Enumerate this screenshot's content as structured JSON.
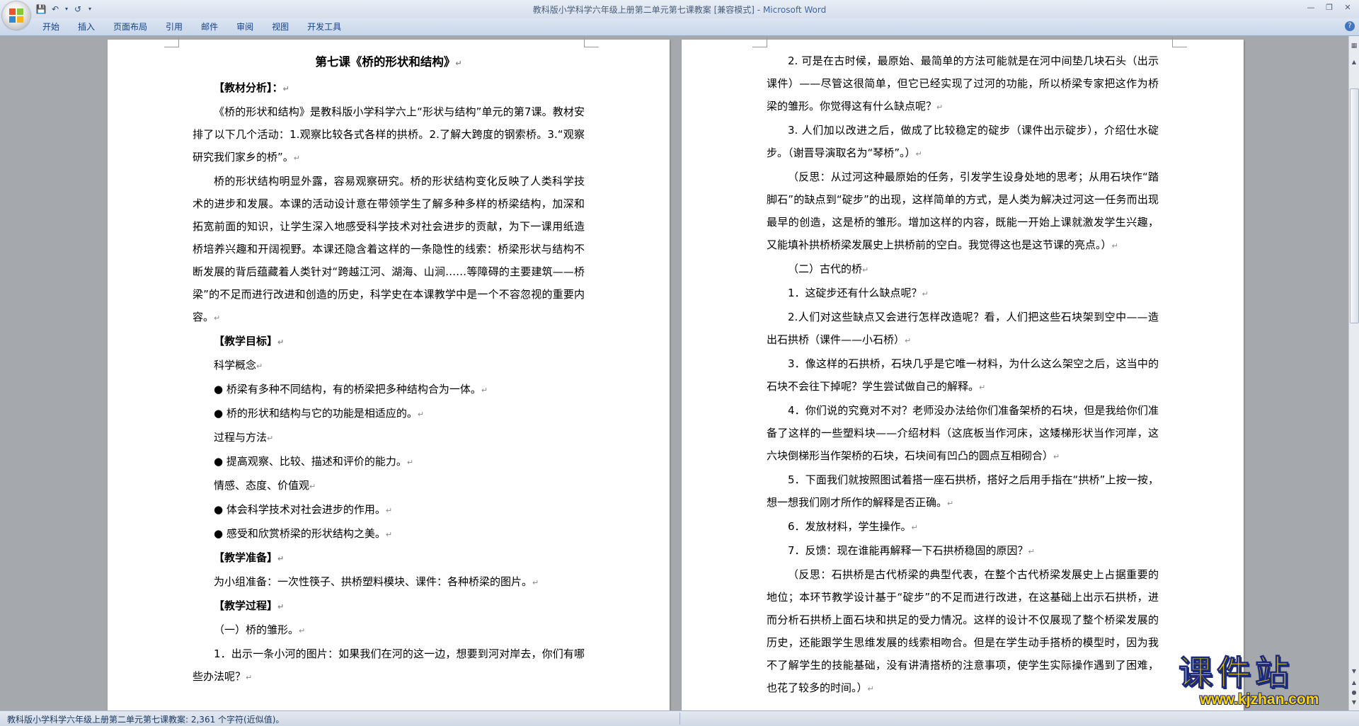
{
  "window": {
    "doc_title": "教科版小学科学六年级上册第二单元第七课教案 [兼容模式]",
    "separator": " - ",
    "app_name": "Microsoft Word"
  },
  "qat": {
    "save_icon": "save-icon",
    "undo_icon": "undo-icon",
    "redo_icon": "redo-icon",
    "customize_icon": "dropdown-icon"
  },
  "ribbon": {
    "tabs": [
      "开始",
      "插入",
      "页面布局",
      "引用",
      "邮件",
      "审阅",
      "视图",
      "开发工具"
    ]
  },
  "page1": {
    "title": "第七课《桥的形状和结构》",
    "paragraphs": [
      "【教材分析】：",
      "《桥的形状和结构》是教科版小学科学六上“形状与结构”单元的第7课。教材安排了以下几个活动：1.观察比较各式各样的拱桥。2.了解大跨度的钢索桥。3.“观察研究我们家乡的桥”。",
      "桥的形状结构明显外露，容易观察研究。桥的形状结构变化反映了人类科学技术的进步和发展。本课的活动设计意在带领学生了解多种多样的桥梁结构，加深和拓宽前面的知识，让学生深入地感受科学技术对社会进步的贡献，为下一课用纸造桥培养兴趣和开阔视野。本课还隐含着这样的一条隐性的线索：桥梁形状与结构不断发展的背后蕴藏着人类针对“跨越江河、湖海、山涧……等障碍的主要建筑——桥梁”的不足而进行改进和创造的历史，科学史在本课教学中是一个不容忽视的重要内容。",
      "【教学目标】",
      "科学概念",
      "● 桥梁有多种不同结构，有的桥梁把多种结构合为一体。",
      "● 桥的形状和结构与它的功能是相适应的。",
      "过程与方法",
      "● 提高观察、比较、描述和评价的能力。",
      "情感、态度、价值观",
      "● 体会科学技术对社会进步的作用。",
      "● 感受和欣赏桥梁的形状结构之美。",
      "【教学准备】",
      "为小组准备：一次性筷子、拱桥塑料模块、课件：各种桥梁的图片。",
      "【教学过程】",
      "（一）桥的雏形。",
      "1．出示一条小河的图片：如果我们在河的这一边，想要到河对岸去，你们有哪些办法呢？"
    ]
  },
  "page2": {
    "paragraphs": [
      "2. 可是在古时候，最原始、最简单的方法可能就是在河中间垫几块石头（出示课件）——尽管这很简单，但它已经实现了过河的功能，所以桥梁专家把这作为桥梁的雏形。你觉得这有什么缺点呢？",
      "3. 人们加以改进之后，做成了比较稳定的碇步（课件出示碇步），介绍仕水碇步。（谢晋导演取名为“琴桥”。）",
      "（反思：从过河这种最原始的任务，引发学生设身处地的思考；从用石块作“踏脚石”的缺点到“碇步”的出现，这样简单的方式，是人类为解决过河这一任务而出现最早的创造，这是桥的雏形。增加这样的内容，既能一开始上课就激发学生兴趣，又能填补拱桥桥梁发展史上拱桥前的空白。我觉得这也是这节课的亮点。）",
      "（二）古代的桥",
      "1．这碇步还有什么缺点呢？",
      "2.人们对这些缺点又会进行怎样改造呢？看，人们把这些石块架到空中——造出石拱桥（课件——小石桥）",
      "3．像这样的石拱桥，石块几乎是它唯一材料，为什么这么架空之后，这当中的石块不会往下掉呢？学生尝试做自己的解释。",
      "4．你们说的究竟对不对？老师没办法给你们准备架桥的石块，但是我给你们准备了这样的一些塑料块——介绍材料（这底板当作河床，这矮梯形状当作河岸，这六块倒梯形当作架桥的石块，石块间有凹凸的圆点互相砌合）",
      "5．下面我们就按照图试着搭一座石拱桥，搭好之后用手指在“拱桥”上按一按，想一想我们刚才所作的解释是否正确。",
      "6．发放材料，学生操作。",
      "7．反馈：现在谁能再解释一下石拱桥稳固的原因？",
      "（反思：石拱桥是古代桥梁的典型代表，在整个古代桥梁发展史上占据重要的地位；本环节教学设计基于“碇步”的不足而进行改进，在这基础上出示石拱桥，进而分析石拱桥上面石块和拱足的受力情况。这样的设计不仅展现了整个桥梁发展的历史，还能跟学生思维发展的线索相吻合。但是在学生动手搭桥的模型时，因为我不了解学生的技能基础，没有讲清搭桥的注意事项，使学生实际操作遇到了困难，也花了较多的时间。）"
    ]
  },
  "status": {
    "text": "教科版小学科学六年级上册第二单元第七课教案: 2,361 个字符(近似值)。"
  },
  "watermark": {
    "title": "课件站",
    "url": "www.kjzhan.com"
  },
  "paragraph_mark": "↵"
}
